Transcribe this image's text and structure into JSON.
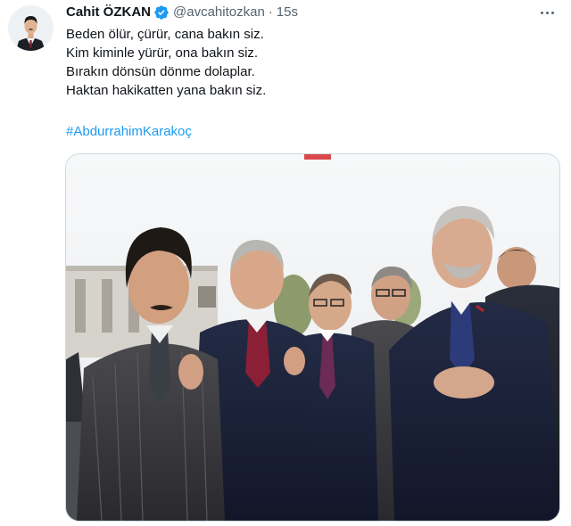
{
  "tweet": {
    "author": {
      "display_name": "Cahit ÖZKAN",
      "handle": "@avcahitozkan",
      "verified": true,
      "avatar_icon": "profile-photo"
    },
    "separator": "·",
    "timestamp": "15s",
    "text_lines": [
      "Beden ölür, çürür, cana bakın siz.",
      "Kim kiminle yürür, ona bakın siz.",
      "Bırakın dönsün dönme dolaplar.",
      "Haktan hakikatten yana bakın siz."
    ],
    "hashtag": "#AbdurrahimKarakoç",
    "media": {
      "kind": "photo",
      "description_icon": "group-photo-image"
    },
    "menu_icon": "more-options-icon"
  },
  "colors": {
    "text_primary": "#0f1419",
    "text_secondary": "#536471",
    "link": "#1d9bf0",
    "verified_badge": "#1d9bf0",
    "media_border": "#cfd9de"
  }
}
